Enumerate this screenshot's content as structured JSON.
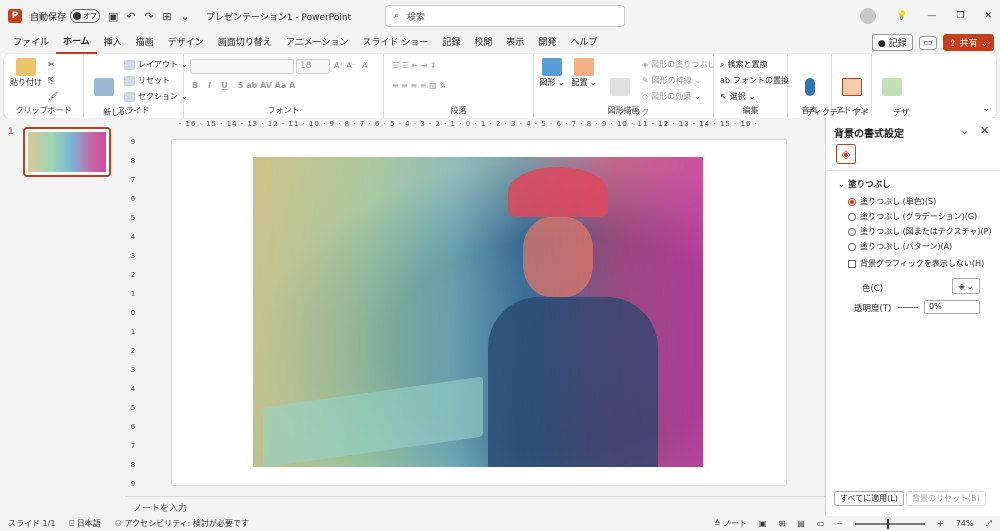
{
  "titlebar": {
    "autosave_label": "自動保存",
    "autosave_state": "オフ",
    "title": "プレゼンテーション1 - PowerPoint",
    "search_placeholder": "検索"
  },
  "tabs": [
    "ファイル",
    "ホーム",
    "挿入",
    "描画",
    "デザイン",
    "画面切り替え",
    "アニメーション",
    "スライド ショー",
    "記録",
    "校閲",
    "表示",
    "開発",
    "ヘルプ"
  ],
  "tabs_active_index": 1,
  "tabs_right": {
    "record": "記録",
    "share": "共有"
  },
  "ribbon": {
    "clipboard": {
      "label": "クリップボード",
      "paste": "貼り付け"
    },
    "slides": {
      "label": "スライド",
      "new_slide": "新しい\nスライド",
      "layout": "レイアウト",
      "reset": "リセット",
      "section": "セクション"
    },
    "font": {
      "label": "フォント",
      "size": "18"
    },
    "paragraph": {
      "label": "段落"
    },
    "drawing": {
      "label": "図形描画",
      "shapes": "図形",
      "arrange": "配置",
      "quick_styles": "クイック\nスタイル",
      "fill": "図形の塗りつぶし",
      "outline": "図形の枠線",
      "effects": "図形の効果"
    },
    "editing": {
      "label": "編集",
      "find_replace": "検索と置換",
      "replace_font": "フォントの置換",
      "select": "選択"
    },
    "voice": {
      "label": "音声",
      "dictate": "ディクテー\nション"
    },
    "addins": {
      "label": "アドイン",
      "addin": "アド\nイン"
    },
    "designer": {
      "label": "デザ\nイナー"
    }
  },
  "thumbs": {
    "slide_number": "1"
  },
  "rulers": {
    "horizontal": "· 16 · 15 · 14 · 13 · 12 · 11 · 10 · 9 · 8 · 7 · 6 · 5 · 4 · 3 · 2 · 1 · 0 · 1 · 2 · 3 · 4 · 5 · 6 · 7 · 8 · 9 · 10 · 11 · 12 · 13 · 14 · 15 · 16 ·",
    "vertical": [
      "9",
      "8",
      "7",
      "6",
      "5",
      "4",
      "3",
      "2",
      "1",
      "0",
      "1",
      "2",
      "3",
      "4",
      "5",
      "6",
      "7",
      "8",
      "9"
    ]
  },
  "notes_placeholder": "ノートを入力",
  "pane": {
    "title": "背景の書式設定",
    "section": "塗りつぶし",
    "options": [
      {
        "label": "塗りつぶし (単色)(S)",
        "selected": true
      },
      {
        "label": "塗りつぶし (グラデーション)(G)",
        "selected": false
      },
      {
        "label": "塗りつぶし (図またはテクスチャ)(P)",
        "selected": false
      },
      {
        "label": "塗りつぶし (パターン)(A)",
        "selected": false
      }
    ],
    "hide_graphics": "背景グラフィックを表示しない(H)",
    "color_label": "色(C)",
    "transparency_label": "透明度(T)",
    "transparency_value": "0%",
    "apply_all": "すべてに適用(L)",
    "reset_bg": "背景のリセット(B)"
  },
  "status": {
    "slide": "スライド 1/1",
    "language": "日本語",
    "accessibility": "アクセシビリティ: 検討が必要です",
    "notes": "ノート",
    "zoom": "74%"
  },
  "colors": {
    "accent": "#c43e1c"
  }
}
